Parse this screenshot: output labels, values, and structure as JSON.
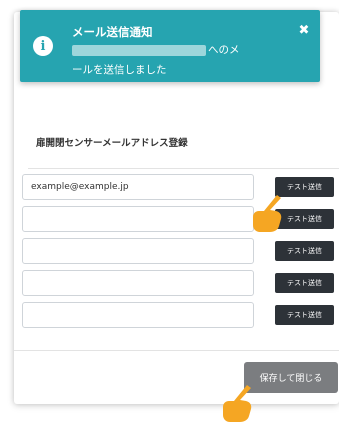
{
  "toast": {
    "icon": "info-icon",
    "title": "メール送信通知",
    "message_suffix": "へのメ",
    "message_line2": "ールを送信しました",
    "close_glyph": "✖"
  },
  "modal": {
    "title": "扉開閉センサーメールアドレス登録",
    "email_fields": [
      {
        "value": "example@example.jp",
        "test_label": "テスト送信"
      },
      {
        "value": "",
        "test_label": "テスト送信"
      },
      {
        "value": "",
        "test_label": "テスト送信"
      },
      {
        "value": "",
        "test_label": "テスト送信"
      },
      {
        "value": "",
        "test_label": "テスト送信"
      }
    ],
    "save_label": "保存して閉じる"
  },
  "colors": {
    "toast_bg": "#26a4b0",
    "test_button_bg": "#2d3238",
    "save_button_bg": "#7b7d80",
    "pointer_hand": "#f5a623"
  },
  "icons": {
    "pointer": "pointer-hand-icon",
    "close": "close-icon"
  }
}
